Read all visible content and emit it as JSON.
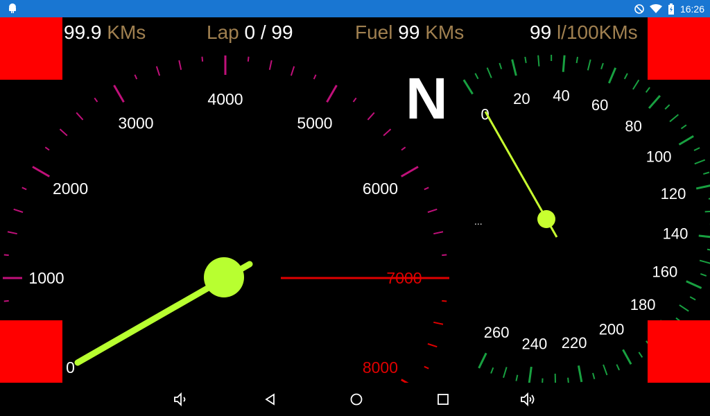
{
  "status": {
    "time": "16:26",
    "icons": [
      "android-icon",
      "do-not-disturb-icon",
      "wifi-icon",
      "battery-charging-icon"
    ]
  },
  "hud": {
    "distance_value": "99.9",
    "distance_unit": "KMs",
    "lap_label": "Lap",
    "lap_value": "0 / 99",
    "fuel_label": "Fuel",
    "fuel_value": "99",
    "fuel_unit": "KMs",
    "consumption_value": "99",
    "consumption_unit": "l/100KMs"
  },
  "gear": "N",
  "indicator": "...",
  "rpm_gauge": {
    "labels": [
      "0",
      "1000",
      "2000",
      "3000",
      "4000",
      "5000",
      "6000",
      "7000",
      "8000"
    ],
    "redline_from": "7000",
    "value": 0,
    "colors": {
      "normal_tick": "#c0107a",
      "red": "#e00000",
      "needle": "#b8ff30",
      "label": "#ffffff"
    }
  },
  "speed_gauge": {
    "labels": [
      "0",
      "20",
      "40",
      "60",
      "80",
      "100",
      "120",
      "140",
      "160",
      "180",
      "200",
      "220",
      "240",
      "260"
    ],
    "value": 0,
    "colors": {
      "tick": "#18a040",
      "needle": "#c8ff30",
      "label": "#ffffff"
    }
  },
  "navbar": {
    "buttons": [
      "volume-down-icon",
      "back-icon",
      "home-icon",
      "recents-icon",
      "volume-up-icon"
    ]
  }
}
